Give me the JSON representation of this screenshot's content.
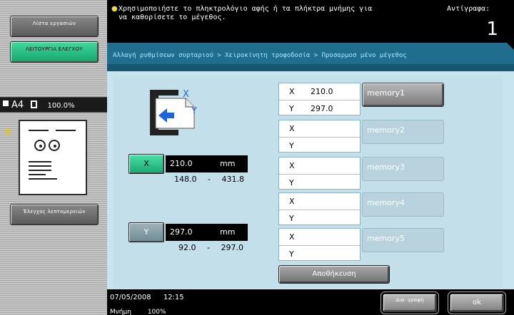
{
  "left_panel": {
    "job_list_label": "Λίστα εργασιών",
    "check_job_label": "ΛΕΙΤΟΥΡΓΙΑ ΕΛΕΓΧΟΥ",
    "paper_size": "A4",
    "orientation_icon": "portrait-page-icon",
    "zoom": "100.0%",
    "check_details_label": "Έλεγχος λεπτομερειών"
  },
  "header": {
    "message": "Χρησιμοποιήστε το πληκτρολόγιο αφής ή τα πλήκτρα μνήμης για να καθορίσετε το μέγεθος.",
    "copies_label": "Αντίγραφα:",
    "copies_value": "1"
  },
  "breadcrumb": {
    "text": "Αλλαγή ρυθμίσεων συρταριού > Χειροκίνητη τροφοδοσία > Προσαρμοσ μένο μέγεθος"
  },
  "size_input": {
    "x": {
      "label": "X",
      "value": "210.0",
      "unit": "mm",
      "range_min": "148.0",
      "range_sep": "-",
      "range_max": "431.8"
    },
    "y": {
      "label": "Y",
      "value": "297.0",
      "unit": "mm",
      "range_min": "92.0",
      "range_sep": "-",
      "range_max": "297.0"
    }
  },
  "memories": [
    {
      "x_label": "X",
      "y_label": "Y",
      "x_value": "210.0",
      "y_value": "297.0",
      "button_label": "memory1"
    },
    {
      "x_label": "X",
      "y_label": "Y",
      "x_value": "",
      "y_value": "",
      "button_label": "memory2"
    },
    {
      "x_label": "X",
      "y_label": "Y",
      "x_value": "",
      "y_value": "",
      "button_label": "memory3"
    },
    {
      "x_label": "X",
      "y_label": "Y",
      "x_value": "",
      "y_value": "",
      "button_label": "memory4"
    },
    {
      "x_label": "X",
      "y_label": "Y",
      "x_value": "",
      "y_value": "",
      "button_label": "memory5"
    }
  ],
  "save_label": "Αποθήκευση",
  "footer": {
    "date": "07/05/2008",
    "time": "12:15",
    "memory_label": "Μνήμη",
    "memory_value": "100%",
    "delete_label": "Δια- γραφή",
    "ok_label": "ok"
  },
  "colors": {
    "accent_green": "#2cc58a",
    "breadcrumb_blue": "#1f6e8e",
    "content_bg": "#c8e5ef"
  }
}
